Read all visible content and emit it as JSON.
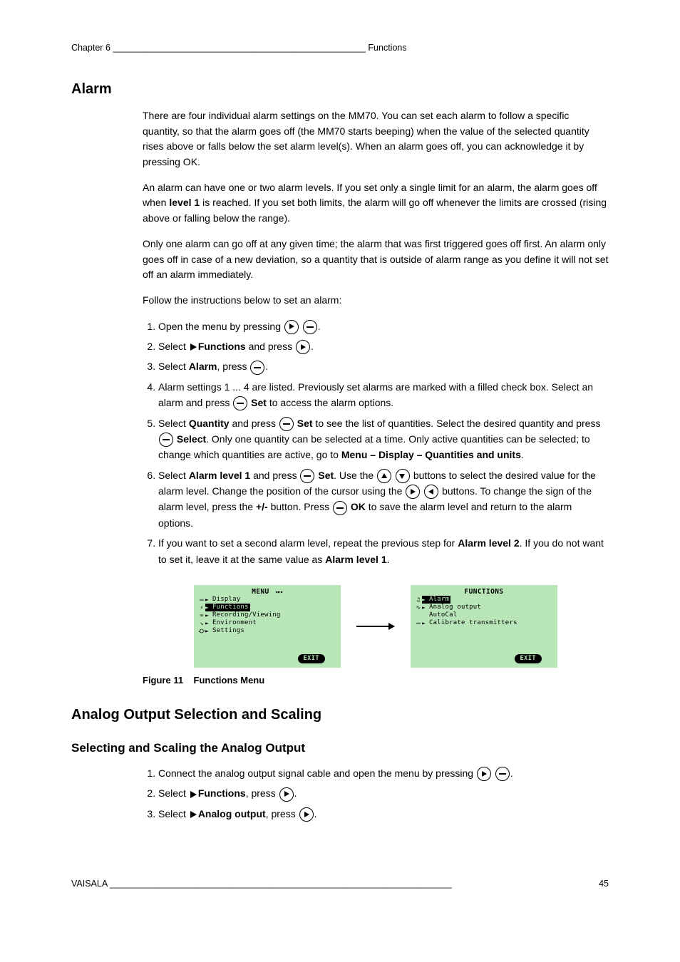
{
  "header": {
    "left_chapter": "Chapter 6 ",
    "left_separator": "___________________________________________________ ",
    "left_title": "Functions",
    "right": ""
  },
  "section1": {
    "title": "Alarm",
    "intro": "There are four individual alarm settings on the MM70. You can set each alarm to follow a specific quantity, so that the alarm goes off (the MM70 starts beeping) when the value of the selected quantity rises above or falls below the set alarm level(s). When an alarm goes off, you can acknowledge it by pressing OK.",
    "p2_pre": "An alarm can have one or two alarm levels. If you set only a single limit for an alarm, the alarm goes off when ",
    "p2_bold": "level 1",
    "p2_post": " is reached. If you set both limits, the alarm will go off whenever the limits are crossed (rising above or falling below the range).",
    "p3": "Only one alarm can go off at any given time; the alarm that was first triggered goes off first. An alarm only goes off in case of a new deviation, so a quantity that is outside of alarm range as you define it will not set off an alarm immediately.",
    "p4": "Follow the instructions below to set an alarm:",
    "steps": {
      "s1_pre": "Open the menu by pressing ",
      "s1_post": ".",
      "s2_pre": "Select ",
      "s2_bold": "Functions",
      "s2_mid": " and press ",
      "s2_post": ".",
      "s3_pre": "Select ",
      "s3_bold": "Alarm",
      "s3_mid": ", press ",
      "s3_post": ".",
      "s4_pre": "Alarm settings 1 ... 4 are listed. Previously set alarms are marked with a filled check box. Select an alarm and press ",
      "s4_bold": "Set",
      "s4_post": " to access the alarm options.",
      "s5_pre": "Select ",
      "s5_bold": "Quantity",
      "s5_mid": " and press ",
      "s5_bold2": "Set",
      "s5_mid2": " to see the list of quantities. Select the desired quantity and press ",
      "s5_bold3": "Select",
      "s5_post": ". Only one quantity can be selected at a time. Only active quantities can be selected; to change which quantities are active, go to ",
      "s5_bold4": "Menu – Display – Quantities and units",
      "s5_end": ".",
      "s6_pre": "Select ",
      "s6_bold": "Alarm level 1",
      "s6_mid": " and press ",
      "s6_bold2": "Set",
      "s6_mid2": ". Use the ",
      "s6_mid3": " buttons to select the desired value for the alarm level. Change the position of the cursor using the ",
      "s6_mid4": " buttons. To change the sign of the alarm level, press the ",
      "s6_bold3": "+/-",
      "s6_mid5": " button. Press ",
      "s6_bold4": "OK",
      "s6_post": " to save the alarm level and return to the alarm options.",
      "s7_pre": "If you want to set a second alarm level, repeat the previous step for ",
      "s7_bold": "Alarm level 2",
      "s7_mid": ". If you do not want to set it, leave it at the same value as ",
      "s7_bold2": "Alarm level 1",
      "s7_post": "."
    }
  },
  "lcd_left": {
    "title_label": "MENU",
    "items": [
      "Display",
      "Functions",
      "Recording/Viewing",
      "Environment",
      "Settings"
    ],
    "selected_index": 1,
    "exit": "EXIT"
  },
  "lcd_right": {
    "title_label": "FUNCTIONS",
    "items": [
      "Alarm",
      "Analog output",
      "AutoCal",
      "Calibrate transmitters"
    ],
    "selected_index": 0,
    "item2_has_arrow": false,
    "exit": "EXIT"
  },
  "figure_caption": {
    "label": "Figure 11",
    "text": "Functions Menu"
  },
  "section2": {
    "title": "Analog Output Selection and Scaling",
    "steps": {
      "s1_pre": "Connect the analog output signal cable and open the menu by pressing ",
      "s1_post": ".",
      "s2_pre": "Select ",
      "s2_bold": "Functions",
      "s2_mid": ", press ",
      "s2_post": ".",
      "s3_pre": "Select ",
      "s3_bold": "Analog output",
      "s3_mid": ", press ",
      "s3_post": "."
    }
  },
  "footer": {
    "left": "VAISALA _____________________________________________________________________",
    "right": "45"
  }
}
